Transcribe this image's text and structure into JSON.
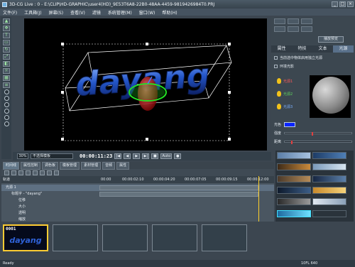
{
  "window": {
    "title": "3D-CG Live : 0 - E:\\CLIP\\HD-GRAPHIC\\user4(HD)_9E53T6A8-22B0-48AA-4459-9819426984T0.PRJ",
    "controls": [
      "_",
      "□",
      "×"
    ]
  },
  "menu": {
    "items": [
      "文件(F)",
      "工具箱(J)",
      "屏幕(S)",
      "查看(V)",
      "滤镜",
      "系统管理(M)",
      "窗口(W)",
      "帮助(H)"
    ]
  },
  "viewport": {
    "logo_text": "dayang"
  },
  "viewbar": {
    "zoom": "30%",
    "template": "不选择模板",
    "timecode": "00:00:11:23",
    "auto_label": "Auto"
  },
  "right_panel": {
    "preset_button": "播放预览",
    "tabs": [
      "属性",
      "特技",
      "文本",
      "光源"
    ],
    "active_tab": "光源",
    "options": [
      "当前选中物体启用独立光源",
      "环境光影"
    ],
    "lights": [
      "光源1",
      "光源2",
      "光源3"
    ],
    "properties": [
      "光色",
      "强度",
      "距离"
    ],
    "light_color": "#0a24ff"
  },
  "timeline": {
    "tabs": [
      "时间线",
      "属性控制",
      "调色板",
      "模板管理",
      "素材管理",
      "音频",
      "属性"
    ],
    "active_tab": "时间线",
    "header_label": "轨道",
    "ruler": [
      "00:00",
      "00:00:02:10",
      "00:00:04:20",
      "00:00:07:05",
      "00:00:09:15",
      "00:00:12:00"
    ],
    "tracks": [
      "光源 1",
      "标题字 - \"dayang\"",
      "位移",
      "大小",
      "透明",
      "缩放"
    ]
  },
  "thumbnails": {
    "first_number": "0001"
  },
  "status": {
    "left": "Ready",
    "right": "10FL 640"
  }
}
